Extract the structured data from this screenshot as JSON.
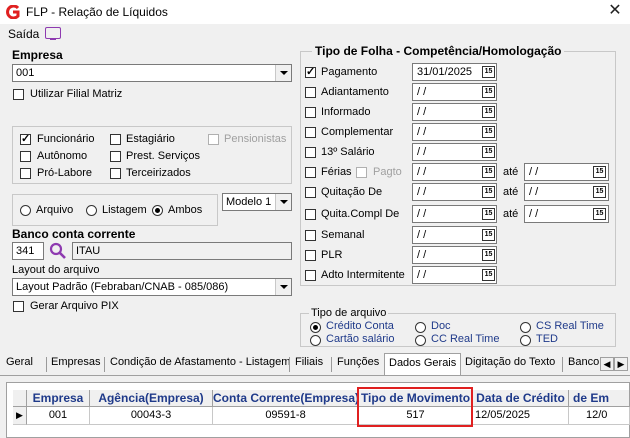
{
  "window": {
    "title": "FLP - Relação de Líquidos",
    "close_glyph": "✕"
  },
  "menu": {
    "saida": "Saída"
  },
  "left": {
    "empresa_label": "Empresa",
    "empresa_value": "001",
    "utilizar_filial": "Utilizar Filial Matriz",
    "tipos": {
      "funcionario": "Funcionário",
      "estagiario": "Estagiário",
      "pensionistas": "Pensionistas",
      "autonomo": "Autônomo",
      "prest_servicos": "Prest. Serviços",
      "pro_labore": "Pró-Labore",
      "terceirizados": "Terceirizados"
    },
    "modelo_value": "Modelo 1",
    "saida_opts": {
      "arquivo": "Arquivo",
      "listagem": "Listagem",
      "ambos": "Ambos"
    },
    "banco_label": "Banco conta corrente",
    "banco_code": "341",
    "banco_name": "ITAU",
    "layout_label": "Layout do arquivo",
    "layout_value": "Layout Padrão (Febraban/CNAB - 085/086)",
    "gerar_pix": "Gerar Arquivo PIX"
  },
  "folha": {
    "title": "Tipo de Folha  -  Competência/Homologação",
    "ate": "até",
    "pagto": "Pagto",
    "rows": [
      {
        "label": "Pagamento",
        "value": "31/01/2025"
      },
      {
        "label": "Adiantamento",
        "value": " /  /"
      },
      {
        "label": "Informado",
        "value": " /  /"
      },
      {
        "label": "Complementar",
        "value": " /  /"
      },
      {
        "label": "13º Salário",
        "value": " /  /"
      },
      {
        "label": "Férias",
        "value": " /  /",
        "ate_value": " /  /"
      },
      {
        "label": "Quitação De",
        "value": " /  /",
        "ate_value": " /  /"
      },
      {
        "label": "Quita.Compl De",
        "value": " /  /",
        "ate_value": " /  /"
      },
      {
        "label": "Semanal",
        "value": " /  /"
      },
      {
        "label": "PLR",
        "value": " /  /"
      },
      {
        "label": "Adto Intermitente",
        "value": " /  /"
      }
    ]
  },
  "tipo_arquivo": {
    "title": "Tipo de arquivo",
    "opts": {
      "credito_conta": "Crédito Conta",
      "cartao_salario": "Cartão salário",
      "doc": "Doc",
      "cc_real_time": "CC Real Time",
      "cs_real_time": "CS Real Time",
      "ted": "TED"
    }
  },
  "tabs": [
    "Geral",
    "Empresas",
    "Condição de Afastamento - Listagem",
    "Filiais",
    "Funções",
    "Dados Gerais",
    "Digitação do Texto",
    "Banco"
  ],
  "grid": {
    "headers": [
      "Empresa",
      "Agência(Empresa)",
      "Conta Corrente(Empresa)",
      "Tipo de Movimento",
      "Data de Crédito",
      "de Em"
    ],
    "row": [
      "001",
      "00043-3",
      "09591-8",
      "517",
      "12/05/2025",
      "12/0"
    ]
  },
  "colors": {
    "accent": "#8e3ab0",
    "header_text": "#1f3a8a",
    "highlight": "#e02020",
    "logo": "#e02020"
  }
}
